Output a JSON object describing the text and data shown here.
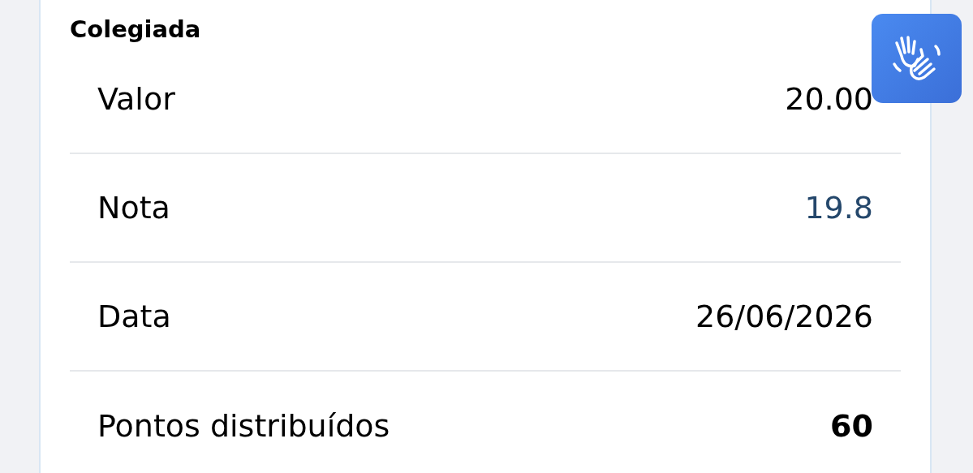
{
  "section": {
    "title": "Colegiada",
    "rows": [
      {
        "label": "Valor",
        "value": "20.00",
        "kind": "plain"
      },
      {
        "label": "Nota",
        "value": "19.8",
        "kind": "highlight"
      },
      {
        "label": "Data",
        "value": "26/06/2026",
        "kind": "plain"
      },
      {
        "label": "Pontos distribuídos",
        "value": "60",
        "kind": "bold"
      }
    ]
  },
  "accessibility_button": {
    "kind": "sign-language"
  }
}
